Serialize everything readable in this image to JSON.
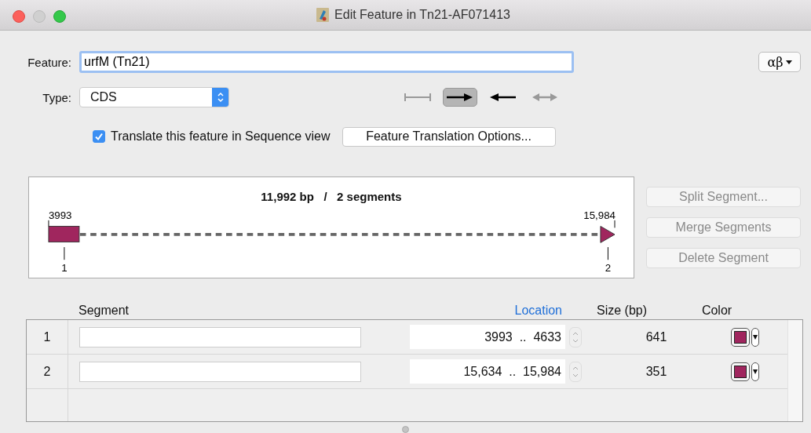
{
  "window": {
    "title": "Edit Feature in Tn21-AF071413"
  },
  "feature": {
    "label": "Feature:",
    "value": "urfM (Tn21)"
  },
  "symbol_menu": {
    "label": "αβ"
  },
  "type": {
    "label": "Type:",
    "value": "CDS"
  },
  "directions": [
    {
      "kind": "none",
      "selected": false
    },
    {
      "kind": "forward",
      "selected": true
    },
    {
      "kind": "reverse",
      "selected": false
    },
    {
      "kind": "both",
      "selected": false
    }
  ],
  "translate": {
    "label": "Translate this feature in Sequence view",
    "checked": true
  },
  "translation_options": {
    "label": "Feature Translation Options..."
  },
  "map": {
    "summary": "11,992 bp   /   2 segments",
    "start": "3993",
    "end": "15,984",
    "segments": [
      {
        "kind": "box",
        "label": "1"
      },
      {
        "kind": "arrow",
        "label": "2"
      }
    ]
  },
  "segment_buttons": [
    {
      "label": "Split Segment...",
      "disabled": true
    },
    {
      "label": "Merge Segments",
      "disabled": true
    },
    {
      "label": "Delete Segment",
      "disabled": true
    }
  ],
  "table": {
    "columns": [
      {
        "label": "Segment",
        "sorted": false
      },
      {
        "label": "Location",
        "sorted": true
      },
      {
        "label": "Size (bp)",
        "sorted": false
      },
      {
        "label": "Color",
        "sorted": false
      }
    ],
    "rows": [
      {
        "number": "1",
        "location": "3993  ..  4633",
        "size": "641",
        "color": "#a0265e"
      },
      {
        "number": "2",
        "location": "15,634  ..  15,984",
        "size": "351",
        "color": "#a0265e"
      }
    ]
  }
}
